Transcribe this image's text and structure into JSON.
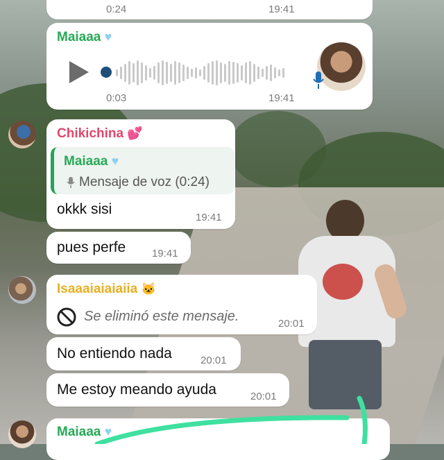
{
  "colors": {
    "sender_maia": "#28a957",
    "sender_chiki": "#e0476c",
    "sender_isa": "#e5b022",
    "timestamp": "#7b7b7b",
    "annotation_stroke": "#3fe0a0"
  },
  "top_bubble": {
    "duration": "0:24",
    "time": "19:41"
  },
  "voice_message": {
    "sender": "Maiaaa",
    "heart_icon": "light-blue-heart",
    "duration": "0:03",
    "time": "19:41"
  },
  "chiki_message": {
    "sender": "Chikichina",
    "heart_icon": "pink-hearts",
    "quote": {
      "sender": "Maiaaa",
      "heart_icon": "light-blue-heart",
      "text": "Mensaje de voz (0:24)"
    },
    "text": "okkk sisi",
    "time": "19:41"
  },
  "chiki_followup": {
    "text": "pues  perfe",
    "time": "19:41"
  },
  "isa_message": {
    "sender": "Isaaaiaiaiaiia",
    "badge_icon": "cat-emoji",
    "deleted_text": "Se eliminó este mensaje.",
    "time": "20:01"
  },
  "isa_msg2": {
    "text": "No entiendo nada",
    "time": "20:01"
  },
  "isa_msg3": {
    "text": "Me estoy meando ayuda",
    "time": "20:01"
  },
  "bottom_message": {
    "sender": "Maiaaa",
    "heart_icon": "light-blue-heart"
  }
}
